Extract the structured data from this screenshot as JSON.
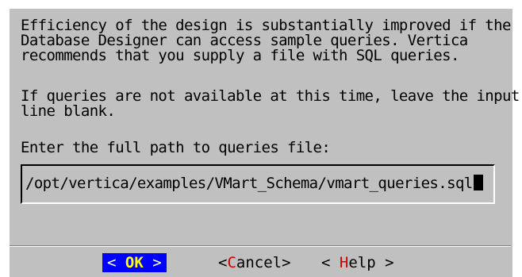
{
  "dialog": {
    "message_para1": "Efficiency of the design is substantially improved if the\nDatabase Designer can access sample queries. Vertica\nrecommends that you supply a file with SQL queries.",
    "message_para2": "If queries are not available at this time, leave the input\nline blank.",
    "prompt": "Enter the full path to queries file:",
    "input_value": "/opt/vertica/examples/VMart_Schema/vmart_queries.sql"
  },
  "buttons": {
    "ok": {
      "open": "< ",
      "hotkey": "OK",
      "close": " >"
    },
    "cancel": {
      "open": "<",
      "hotkey": "C",
      "rest": "ancel",
      "close": ">"
    },
    "help": {
      "open": "< ",
      "hotkey": "H",
      "rest": "elp",
      "close": " >"
    }
  },
  "colors": {
    "dialog_bg": "#c0c0c0",
    "selected_button_bg": "#0000ff",
    "selected_hotkey": "#ffff00",
    "hotkey": "#d00000"
  }
}
